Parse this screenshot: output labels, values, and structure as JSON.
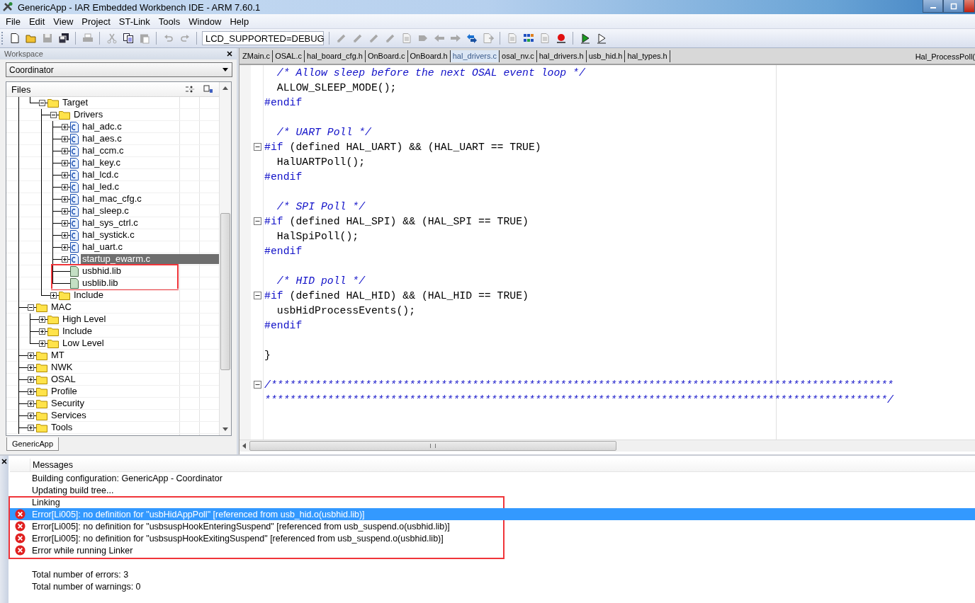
{
  "window": {
    "title": "GenericApp - IAR Embedded Workbench IDE - ARM 7.60.1"
  },
  "menu": [
    "File",
    "Edit",
    "View",
    "Project",
    "ST-Link",
    "Tools",
    "Window",
    "Help"
  ],
  "toolbar": {
    "groups": [
      [
        {
          "kind": "new",
          "disabled": false
        },
        {
          "kind": "open",
          "disabled": false
        },
        {
          "kind": "save",
          "disabled": true
        },
        {
          "kind": "save_all",
          "disabled": false
        }
      ],
      [
        {
          "kind": "print",
          "disabled": true
        }
      ],
      [
        {
          "kind": "cut",
          "disabled": true
        },
        {
          "kind": "copy",
          "disabled": false
        },
        {
          "kind": "paste",
          "disabled": true
        }
      ],
      [
        {
          "kind": "undo",
          "disabled": true
        },
        {
          "kind": "redo",
          "disabled": true
        }
      ],
      [
        {
          "kind": "combo",
          "value": "LCD_SUPPORTED=DEBUG"
        }
      ],
      [
        {
          "kind": "pen",
          "disabled": true
        },
        {
          "kind": "pen",
          "disabled": true
        },
        {
          "kind": "pen",
          "disabled": true
        },
        {
          "kind": "pen",
          "disabled": true
        },
        {
          "kind": "doc",
          "disabled": true
        },
        {
          "kind": "tag",
          "disabled": true
        },
        {
          "kind": "arrow_left",
          "disabled": true
        },
        {
          "kind": "arrow_right",
          "disabled": true
        },
        {
          "kind": "swap",
          "disabled": false
        },
        {
          "kind": "doc_arrow",
          "disabled": true
        }
      ],
      [
        {
          "kind": "doc",
          "disabled": true
        },
        {
          "kind": "grid",
          "disabled": false
        },
        {
          "kind": "doc",
          "disabled": true
        },
        {
          "kind": "breakpoint",
          "disabled": false
        }
      ],
      [
        {
          "kind": "play",
          "disabled": false
        },
        {
          "kind": "play_outline",
          "disabled": false
        }
      ]
    ]
  },
  "workspace": {
    "title": "Workspace",
    "configuration": "Coordinator",
    "column": "Files",
    "tree": {
      "partial_branch": [
        {
          "label": "Target",
          "kind": "folder",
          "expanded": true,
          "selected": false,
          "annotated": false,
          "children": [
            {
              "label": "Drivers",
              "kind": "folder",
              "expanded": true,
              "selected": false,
              "annotated": false,
              "children": [
                {
                  "label": "hal_adc.c",
                  "kind": "c_file",
                  "expanded": false,
                  "selected": false,
                  "annotated": false
                },
                {
                  "label": "hal_aes.c",
                  "kind": "c_file",
                  "expanded": false,
                  "selected": false,
                  "annotated": false
                },
                {
                  "label": "hal_ccm.c",
                  "kind": "c_file",
                  "expanded": false,
                  "selected": false,
                  "annotated": false
                },
                {
                  "label": "hal_key.c",
                  "kind": "c_file",
                  "expanded": false,
                  "selected": false,
                  "annotated": false
                },
                {
                  "label": "hal_lcd.c",
                  "kind": "c_file",
                  "expanded": false,
                  "selected": false,
                  "annotated": false
                },
                {
                  "label": "hal_led.c",
                  "kind": "c_file",
                  "expanded": false,
                  "selected": false,
                  "annotated": false
                },
                {
                  "label": "hal_mac_cfg.c",
                  "kind": "c_file",
                  "expanded": false,
                  "selected": false,
                  "annotated": false
                },
                {
                  "label": "hal_sleep.c",
                  "kind": "c_file",
                  "expanded": false,
                  "selected": false,
                  "annotated": false
                },
                {
                  "label": "hal_sys_ctrl.c",
                  "kind": "c_file",
                  "expanded": false,
                  "selected": false,
                  "annotated": false
                },
                {
                  "label": "hal_systick.c",
                  "kind": "c_file",
                  "expanded": false,
                  "selected": false,
                  "annotated": false
                },
                {
                  "label": "hal_uart.c",
                  "kind": "c_file",
                  "expanded": false,
                  "selected": false,
                  "annotated": false
                },
                {
                  "label": "startup_ewarm.c",
                  "kind": "c_file",
                  "expanded": false,
                  "selected": true,
                  "annotated": false
                },
                {
                  "label": "usbhid.lib",
                  "kind": "lib",
                  "selected": false,
                  "annotated": true
                },
                {
                  "label": "usblib.lib",
                  "kind": "lib",
                  "selected": false,
                  "annotated": true
                }
              ]
            },
            {
              "label": "Include",
              "kind": "folder",
              "expanded": false,
              "selected": false,
              "annotated": false
            }
          ]
        }
      ],
      "items": [
        {
          "label": "MAC",
          "kind": "folder",
          "expanded": true,
          "selected": false,
          "annotated": false,
          "children": [
            {
              "label": "High Level",
              "kind": "folder",
              "expanded": false,
              "selected": false,
              "annotated": false
            },
            {
              "label": "Include",
              "kind": "folder",
              "expanded": false,
              "selected": false,
              "annotated": false
            },
            {
              "label": "Low Level",
              "kind": "folder",
              "expanded": false,
              "selected": false,
              "annotated": false
            }
          ]
        },
        {
          "label": "MT",
          "kind": "folder",
          "expanded": false,
          "selected": false,
          "annotated": false
        },
        {
          "label": "NWK",
          "kind": "folder",
          "expanded": false,
          "selected": false,
          "annotated": false
        },
        {
          "label": "OSAL",
          "kind": "folder",
          "expanded": false,
          "selected": false,
          "annotated": false
        },
        {
          "label": "Profile",
          "kind": "folder",
          "expanded": false,
          "selected": false,
          "annotated": false
        },
        {
          "label": "Security",
          "kind": "folder",
          "expanded": false,
          "selected": false,
          "annotated": false
        },
        {
          "label": "Services",
          "kind": "folder",
          "expanded": false,
          "selected": false,
          "annotated": false
        },
        {
          "label": "Tools",
          "kind": "folder",
          "expanded": false,
          "selected": false,
          "annotated": false
        }
      ]
    },
    "tabs": [
      {
        "label": "GenericApp",
        "selected": true
      }
    ]
  },
  "editor": {
    "tabs": [
      {
        "label": "ZMain.c",
        "selected": false
      },
      {
        "label": "OSAL.c",
        "selected": false
      },
      {
        "label": "hal_board_cfg.h",
        "selected": false
      },
      {
        "label": "OnBoard.c",
        "selected": false
      },
      {
        "label": "OnBoard.h",
        "selected": false
      },
      {
        "label": "hal_drivers.c",
        "selected": true
      },
      {
        "label": "osal_nv.c",
        "selected": false
      },
      {
        "label": "hal_drivers.h",
        "selected": false
      },
      {
        "label": "usb_hid.h",
        "selected": false
      },
      {
        "label": "hal_types.h",
        "selected": false
      }
    ],
    "function": "Hal_ProcessPoll(",
    "lines": [
      {
        "kind": "comment",
        "text": "  /* Allow sleep before the next OSAL event loop */"
      },
      {
        "kind": "code",
        "text": "  ALLOW_SLEEP_MODE();"
      },
      {
        "kind": "directive",
        "keyword": "#endif"
      },
      {
        "kind": "blank"
      },
      {
        "kind": "comment",
        "text": "  /* UART Poll */"
      },
      {
        "kind": "directive",
        "keyword": "#if",
        "text": " (defined HAL_UART) && (HAL_UART == TRUE)",
        "fold": true
      },
      {
        "kind": "code",
        "text": "  HalUARTPoll();"
      },
      {
        "kind": "directive",
        "keyword": "#endif"
      },
      {
        "kind": "blank"
      },
      {
        "kind": "comment",
        "text": "  /* SPI Poll */"
      },
      {
        "kind": "directive",
        "keyword": "#if",
        "text": " (defined HAL_SPI) && (HAL_SPI == TRUE)",
        "fold": true
      },
      {
        "kind": "code",
        "text": "  HalSpiPoll();"
      },
      {
        "kind": "directive",
        "keyword": "#endif"
      },
      {
        "kind": "blank"
      },
      {
        "kind": "comment",
        "text": "  /* HID poll */"
      },
      {
        "kind": "directive",
        "keyword": "#if",
        "text": " (defined HAL_HID) && (HAL_HID == TRUE)",
        "fold": true
      },
      {
        "kind": "code",
        "text": "  usbHidProcessEvents();"
      },
      {
        "kind": "directive",
        "keyword": "#endif"
      },
      {
        "kind": "blank"
      },
      {
        "kind": "code",
        "text": "}"
      },
      {
        "kind": "blank"
      },
      {
        "kind": "comment",
        "text": "/***************************************************************************************************",
        "fold": true
      },
      {
        "kind": "comment",
        "text": "***************************************************************************************************/"
      }
    ]
  },
  "messages": {
    "header": "Messages",
    "rows": [
      {
        "kind": "info",
        "text": "Building configuration: GenericApp - Coordinator",
        "selected": false,
        "annotated": false
      },
      {
        "kind": "info",
        "text": "Updating build tree...",
        "selected": false,
        "annotated": false
      },
      {
        "kind": "info",
        "text": "Linking",
        "selected": false,
        "annotated": true
      },
      {
        "kind": "error",
        "text": "Error[Li005]: no definition for \"usbHidAppPoll\" [referenced from usb_hid.o(usbhid.lib)]",
        "selected": true,
        "annotated": true
      },
      {
        "kind": "error",
        "text": "Error[Li005]: no definition for \"usbsuspHookEnteringSuspend\" [referenced from usb_suspend.o(usbhid.lib)]",
        "selected": false,
        "annotated": true
      },
      {
        "kind": "error",
        "text": "Error[Li005]: no definition for \"usbsuspHookExitingSuspend\" [referenced from usb_suspend.o(usbhid.lib)]",
        "selected": false,
        "annotated": true
      },
      {
        "kind": "error",
        "text": "Error while running Linker",
        "selected": false,
        "annotated": true
      },
      {
        "kind": "summary",
        "text": "Total number of errors: 3",
        "selected": false,
        "annotated": false
      },
      {
        "kind": "summary",
        "text": "Total number of warnings: 0",
        "selected": false,
        "annotated": false
      }
    ]
  }
}
